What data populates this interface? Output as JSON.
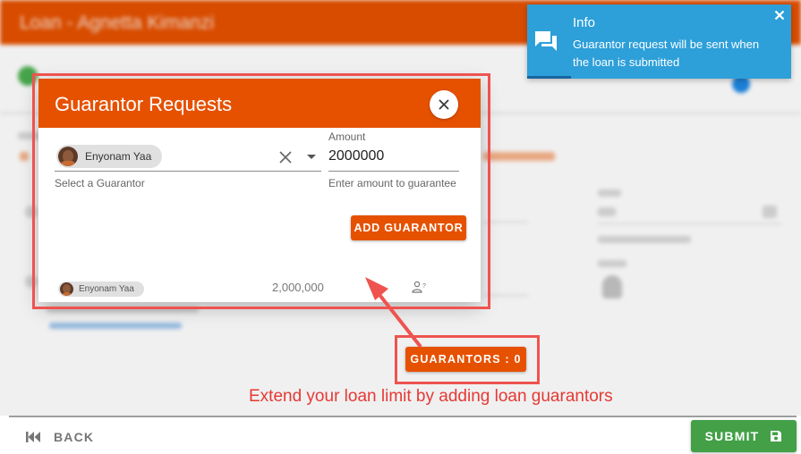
{
  "app": {
    "title": "Loan - Agnetta Kimanzi"
  },
  "dialog": {
    "title": "Guarantor Requests",
    "selected_guarantor": "Enyonam Yaa",
    "select_helper": "Select a Guarantor",
    "amount_label": "Amount",
    "amount_value": "2000000",
    "amount_helper": "Enter amount to guarantee",
    "add_button_label": "ADD GUARANTOR",
    "rows": [
      {
        "name": "Enyonam Yaa",
        "amount": "2,000,000",
        "icon": "person-pending-icon"
      }
    ]
  },
  "main": {
    "guarantors_button_label": "GUARANTORS : 0",
    "annotation_text": "Extend your loan limit by adding loan guarantors"
  },
  "footer": {
    "back_label": "BACK",
    "submit_label": "SUBMIT"
  },
  "toast": {
    "title": "Info",
    "message": "Guarantor request will be sent when the loan is submitted"
  },
  "colors": {
    "primary": "#e65100",
    "success": "#43a047",
    "info": "#2d9fd9",
    "annotation": "#ef5350"
  }
}
